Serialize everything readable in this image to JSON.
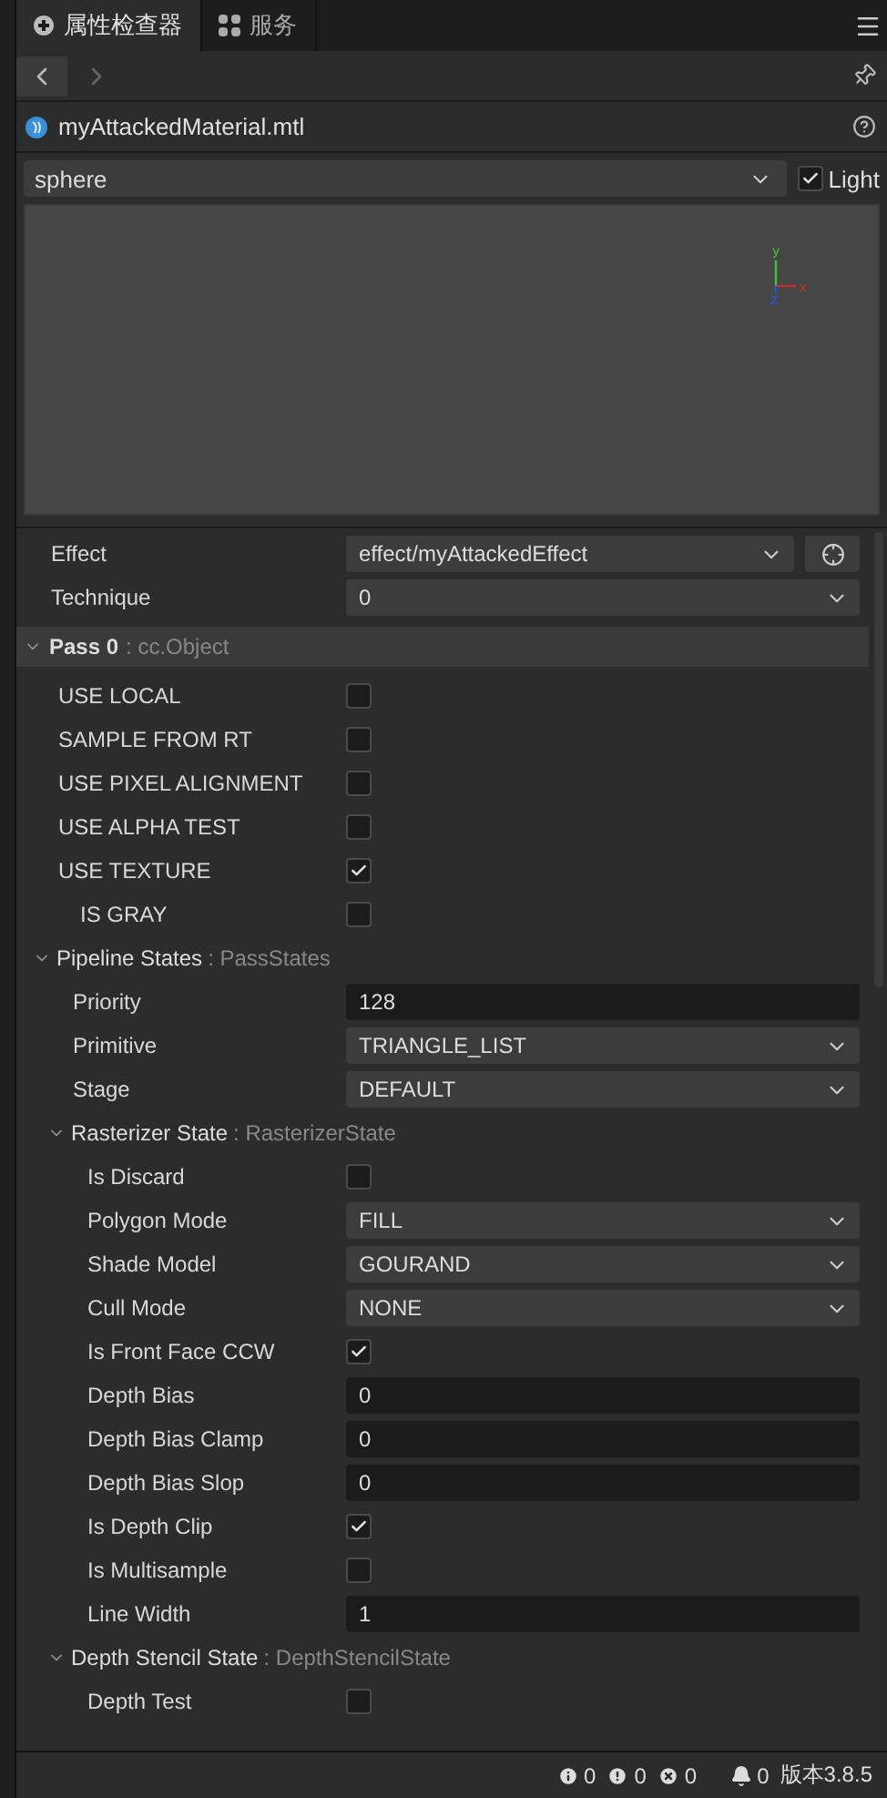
{
  "tabs": [
    {
      "label": "属性检查器",
      "kind": "inspector",
      "selected": true
    },
    {
      "label": "服务",
      "kind": "services",
      "selected": false
    }
  ],
  "nav": {
    "back_enabled": true,
    "forward_enabled": false
  },
  "asset": {
    "name": "myAttackedMaterial.mtl"
  },
  "preview": {
    "mesh": "sphere",
    "light_label": "Light",
    "light": true,
    "axes": {
      "y": "y",
      "x": "x",
      "z": "z"
    }
  },
  "properties": [
    {
      "kind": "select",
      "label": "Effect",
      "value": "effect/myAttackedEffect",
      "locate": true
    },
    {
      "kind": "select",
      "label": "Technique",
      "value": "0"
    },
    {
      "kind": "section",
      "label": "Pass 0",
      "type": ": cc.Object",
      "expanded": true,
      "children": [
        {
          "kind": "checkbox",
          "label": "USE LOCAL",
          "checked": false
        },
        {
          "kind": "checkbox",
          "label": "SAMPLE FROM RT",
          "checked": false
        },
        {
          "kind": "checkbox",
          "label": "USE PIXEL ALIGNMENT",
          "checked": false
        },
        {
          "kind": "checkbox",
          "label": "USE ALPHA TEST",
          "checked": false
        },
        {
          "kind": "checkbox",
          "label": "USE TEXTURE",
          "checked": true,
          "children": [
            {
              "kind": "checkbox",
              "label": "IS GRAY",
              "checked": false
            }
          ]
        },
        {
          "kind": "group",
          "label": "Pipeline States",
          "type": ": PassStates",
          "expanded": true,
          "children": [
            {
              "kind": "input",
              "label": "Priority",
              "value": "128"
            },
            {
              "kind": "select",
              "label": "Primitive",
              "value": "TRIANGLE_LIST"
            },
            {
              "kind": "select",
              "label": "Stage",
              "value": "DEFAULT"
            },
            {
              "kind": "group",
              "label": "Rasterizer State",
              "type": ": RasterizerState",
              "expanded": true,
              "children": [
                {
                  "kind": "checkbox",
                  "label": "Is Discard",
                  "checked": false
                },
                {
                  "kind": "select",
                  "label": "Polygon Mode",
                  "value": "FILL"
                },
                {
                  "kind": "select",
                  "label": "Shade Model",
                  "value": "GOURAND"
                },
                {
                  "kind": "select",
                  "label": "Cull Mode",
                  "value": "NONE"
                },
                {
                  "kind": "checkbox",
                  "label": "Is Front Face CCW",
                  "checked": true
                },
                {
                  "kind": "input",
                  "label": "Depth Bias",
                  "value": "0"
                },
                {
                  "kind": "input",
                  "label": "Depth Bias Clamp",
                  "value": "0"
                },
                {
                  "kind": "input",
                  "label": "Depth Bias Slop",
                  "value": "0"
                },
                {
                  "kind": "checkbox",
                  "label": "Is Depth Clip",
                  "checked": true
                },
                {
                  "kind": "checkbox",
                  "label": "Is Multisample",
                  "checked": false
                },
                {
                  "kind": "input",
                  "label": "Line Width",
                  "value": "1"
                }
              ]
            },
            {
              "kind": "group",
              "label": "Depth Stencil State",
              "type": ": DepthStencilState",
              "expanded": true,
              "children": [
                {
                  "kind": "checkbox",
                  "label": "Depth Test",
                  "checked": false
                }
              ]
            }
          ]
        }
      ]
    }
  ],
  "status_bar": [
    {
      "kind": "info",
      "count": "0"
    },
    {
      "kind": "warning",
      "count": "0"
    },
    {
      "kind": "error",
      "count": "0"
    },
    {
      "kind": "notification",
      "count": "0"
    }
  ],
  "version": "版本3.8.5"
}
